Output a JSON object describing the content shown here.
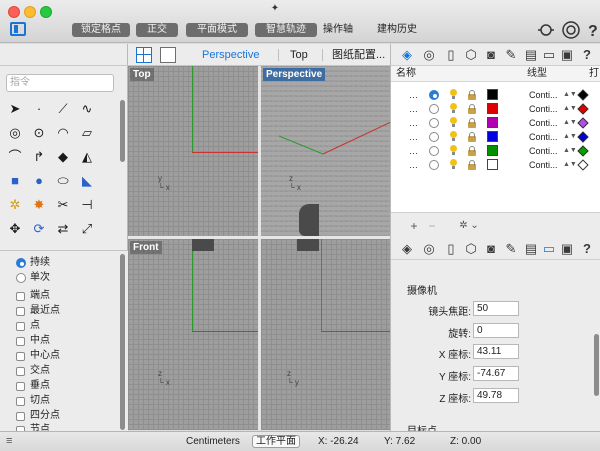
{
  "titlebar": {
    "snap_buttons": [
      "锁定格点",
      "正交",
      "平面模式",
      "智慧轨迹"
    ],
    "plain_buttons": [
      "操作轴",
      "建构历史"
    ]
  },
  "left": {
    "command_placeholder": "指令",
    "osnap_modes": [
      "持续",
      "单次"
    ],
    "osnap_items": [
      "端点",
      "最近点",
      "点",
      "中点",
      "中心点",
      "交点",
      "垂点",
      "切点",
      "四分点",
      "节点"
    ]
  },
  "viewport_bar": {
    "tabs": [
      "Perspective",
      "Top",
      "图纸配置..."
    ]
  },
  "viewports": {
    "top": "Top",
    "perspective": "Perspective",
    "front": "Front",
    "right_hidden": ""
  },
  "layers": {
    "headers": {
      "name": "名称",
      "linetype": "线型",
      "print": "打"
    },
    "rows": [
      {
        "dots": "…",
        "current": true,
        "color": "#000000",
        "linetype": "Conti...",
        "print_color": "#000000"
      },
      {
        "dots": "…",
        "current": false,
        "color": "#e00000",
        "linetype": "Conti...",
        "print_color": "#e00000"
      },
      {
        "dots": "…",
        "current": false,
        "color": "#b000b0",
        "linetype": "Conti...",
        "print_color": "#b050e0"
      },
      {
        "dots": "…",
        "current": false,
        "color": "#0000e0",
        "linetype": "Conti...",
        "print_color": "#0000d0"
      },
      {
        "dots": "…",
        "current": false,
        "color": "#009000",
        "linetype": "Conti...",
        "print_color": "#00a000"
      },
      {
        "dots": "…",
        "current": false,
        "color": "#ffffff",
        "linetype": "Conti...",
        "print_color": "#ffffff"
      }
    ],
    "add_label": "+",
    "remove_label": "−",
    "gear_label": "✲ ⌄"
  },
  "properties": {
    "section_camera": "摄像机",
    "focal_label": "镜头焦距:",
    "focal_value": "50",
    "rotation_label": "旋转:",
    "rotation_value": "0",
    "x_label": "X 座标:",
    "x_value": "43.11",
    "y_label": "Y 座标:",
    "y_value": "-74.67",
    "z_label": "Z 座标:",
    "z_value": "49.78",
    "section_target": "目标点"
  },
  "status": {
    "units": "Centimeters",
    "cplane": "工作平面",
    "x": "X: -26.24",
    "y": "Y: 7.62",
    "z": "Z: 0.00"
  },
  "colors": {
    "accent": "#1a74d8",
    "active_viewport": "#3f6da2",
    "axis_x": "#c83232",
    "axis_y": "#2e9b2e"
  },
  "icons": [
    "panel-toggle-icon",
    "gumball-icon",
    "target-icon",
    "layers-icon",
    "render-icon",
    "document-icon",
    "camera-icon",
    "lighting-icon",
    "notes-icon",
    "display-icon",
    "help-icon"
  ]
}
